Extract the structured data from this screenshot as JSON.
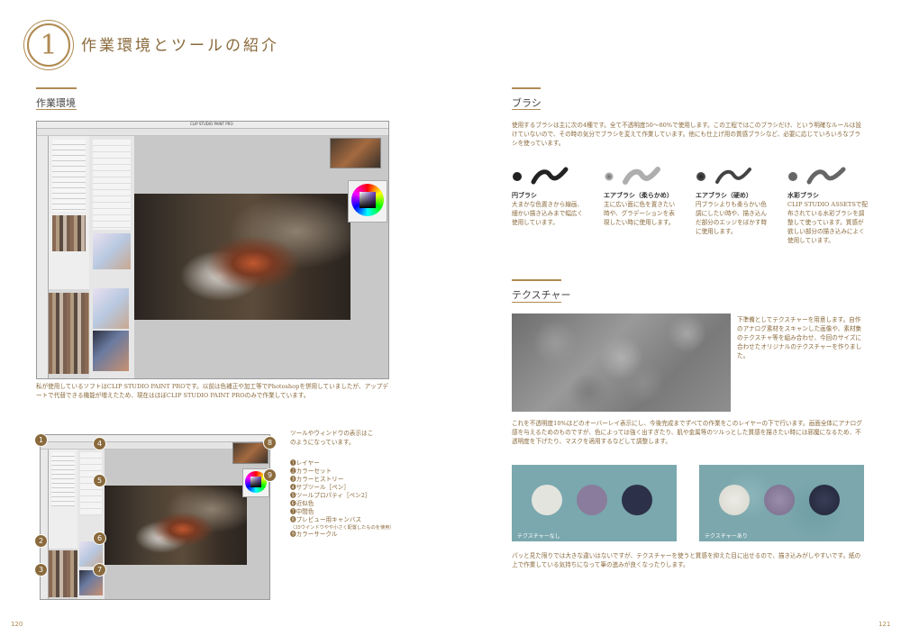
{
  "header": {
    "chapter_number": "1",
    "chapter_title": "作業環境とツールの紹介"
  },
  "left": {
    "section_title": "作業環境",
    "app_window_title": "CLIP STUDIO PAINT PRO",
    "paragraph": "私が使用しているソフトはCLIP STUDIO PAINT PROです。以前は色補正や加工等でPhotoshopを併用していましたが、アップデートで代替できる機能が増えたため、現在はほぼCLIP STUDIO PAINT PROのみで作業しています。",
    "intro": "ツールやウィンドウの表示はこのようになっています。",
    "legend": [
      "❶レイヤー",
      "❷カラーセット",
      "❸カラーヒストリー",
      "❹サブツール［ペン］",
      "❺ツールプロパティ［ペン2］",
      "❻近似色",
      "❼中間色",
      "❽プレビュー用キャンバス",
      "❾カラーサークル"
    ],
    "legend_note": "（35ウインドウやや小さく配置したものを使用）",
    "callouts": [
      "1",
      "2",
      "3",
      "4",
      "5",
      "6",
      "7",
      "8",
      "9"
    ],
    "page_number": "120"
  },
  "right": {
    "brush_section_title": "ブラシ",
    "brush_paragraph": "使用するブラシは主に次の4種です。全て不透明度50〜80%で使用します。この工程ではこのブラシだけ、という明確なルールは設けていないので、その時の気分でブラシを変えて作業しています。他にも仕上げ用の質感ブラシなど、必要に応じていろいろなブラシを使っています。",
    "brushes": [
      {
        "name": "円ブラシ",
        "desc": "大まかな色置きから線画、細かい描き込みまで幅広く使用しています。",
        "color": "#222222"
      },
      {
        "name": "エアブラシ（柔らかめ）",
        "desc": "主に広い面に色を置きたい時や、グラデーションを表現したい時に使用します。",
        "color": "#888888"
      },
      {
        "name": "エアブラシ（硬め）",
        "desc": "円ブラシよりも柔らかい色調にしたい時や、描き込んだ部分のエッジをぼかす時に使用します。",
        "color": "#444444"
      },
      {
        "name": "水彩ブラシ",
        "desc": "CLIP STUDIO ASSETSで配布されている水彩ブラシを調整して使っています。質感が欲しい部分の描き込みによく使用しています。",
        "color": "#666666"
      }
    ],
    "texture_section_title": "テクスチャー",
    "texture_desc": "下準備としてテクスチャーを用意します。自作のアナログ素材をスキャンした画像や、素材集のテクスチャ等を組み合わせ、今回のサイズに合わせたオリジナルのテクスチャーを作りました。",
    "texture_paragraph": "これを不透明度10%ほどのオーバーレイ表示にし、今後完成までずべての作業をこのレイヤーの下で行います。画面全体にアナログ感を与えるためのものですが、色によっては強く出すぎたり、肌や金属等のツルっとした質感を描きたい時には邪魔になるため、不透明度を下げたり、マスクを適用するなどして調整します。",
    "compare": [
      {
        "label": "テクスチャーなし"
      },
      {
        "label": "テクスチャーあり"
      }
    ],
    "compare_paragraph": "パッと見た限りでは大きな違いはないですが、テクスチャーを使うと質感を抑えた目に出せるので、描き込みがしやすいです。紙の上で作業している気持ちになって筆の進みが良くなったりします。",
    "page_number": "121"
  }
}
